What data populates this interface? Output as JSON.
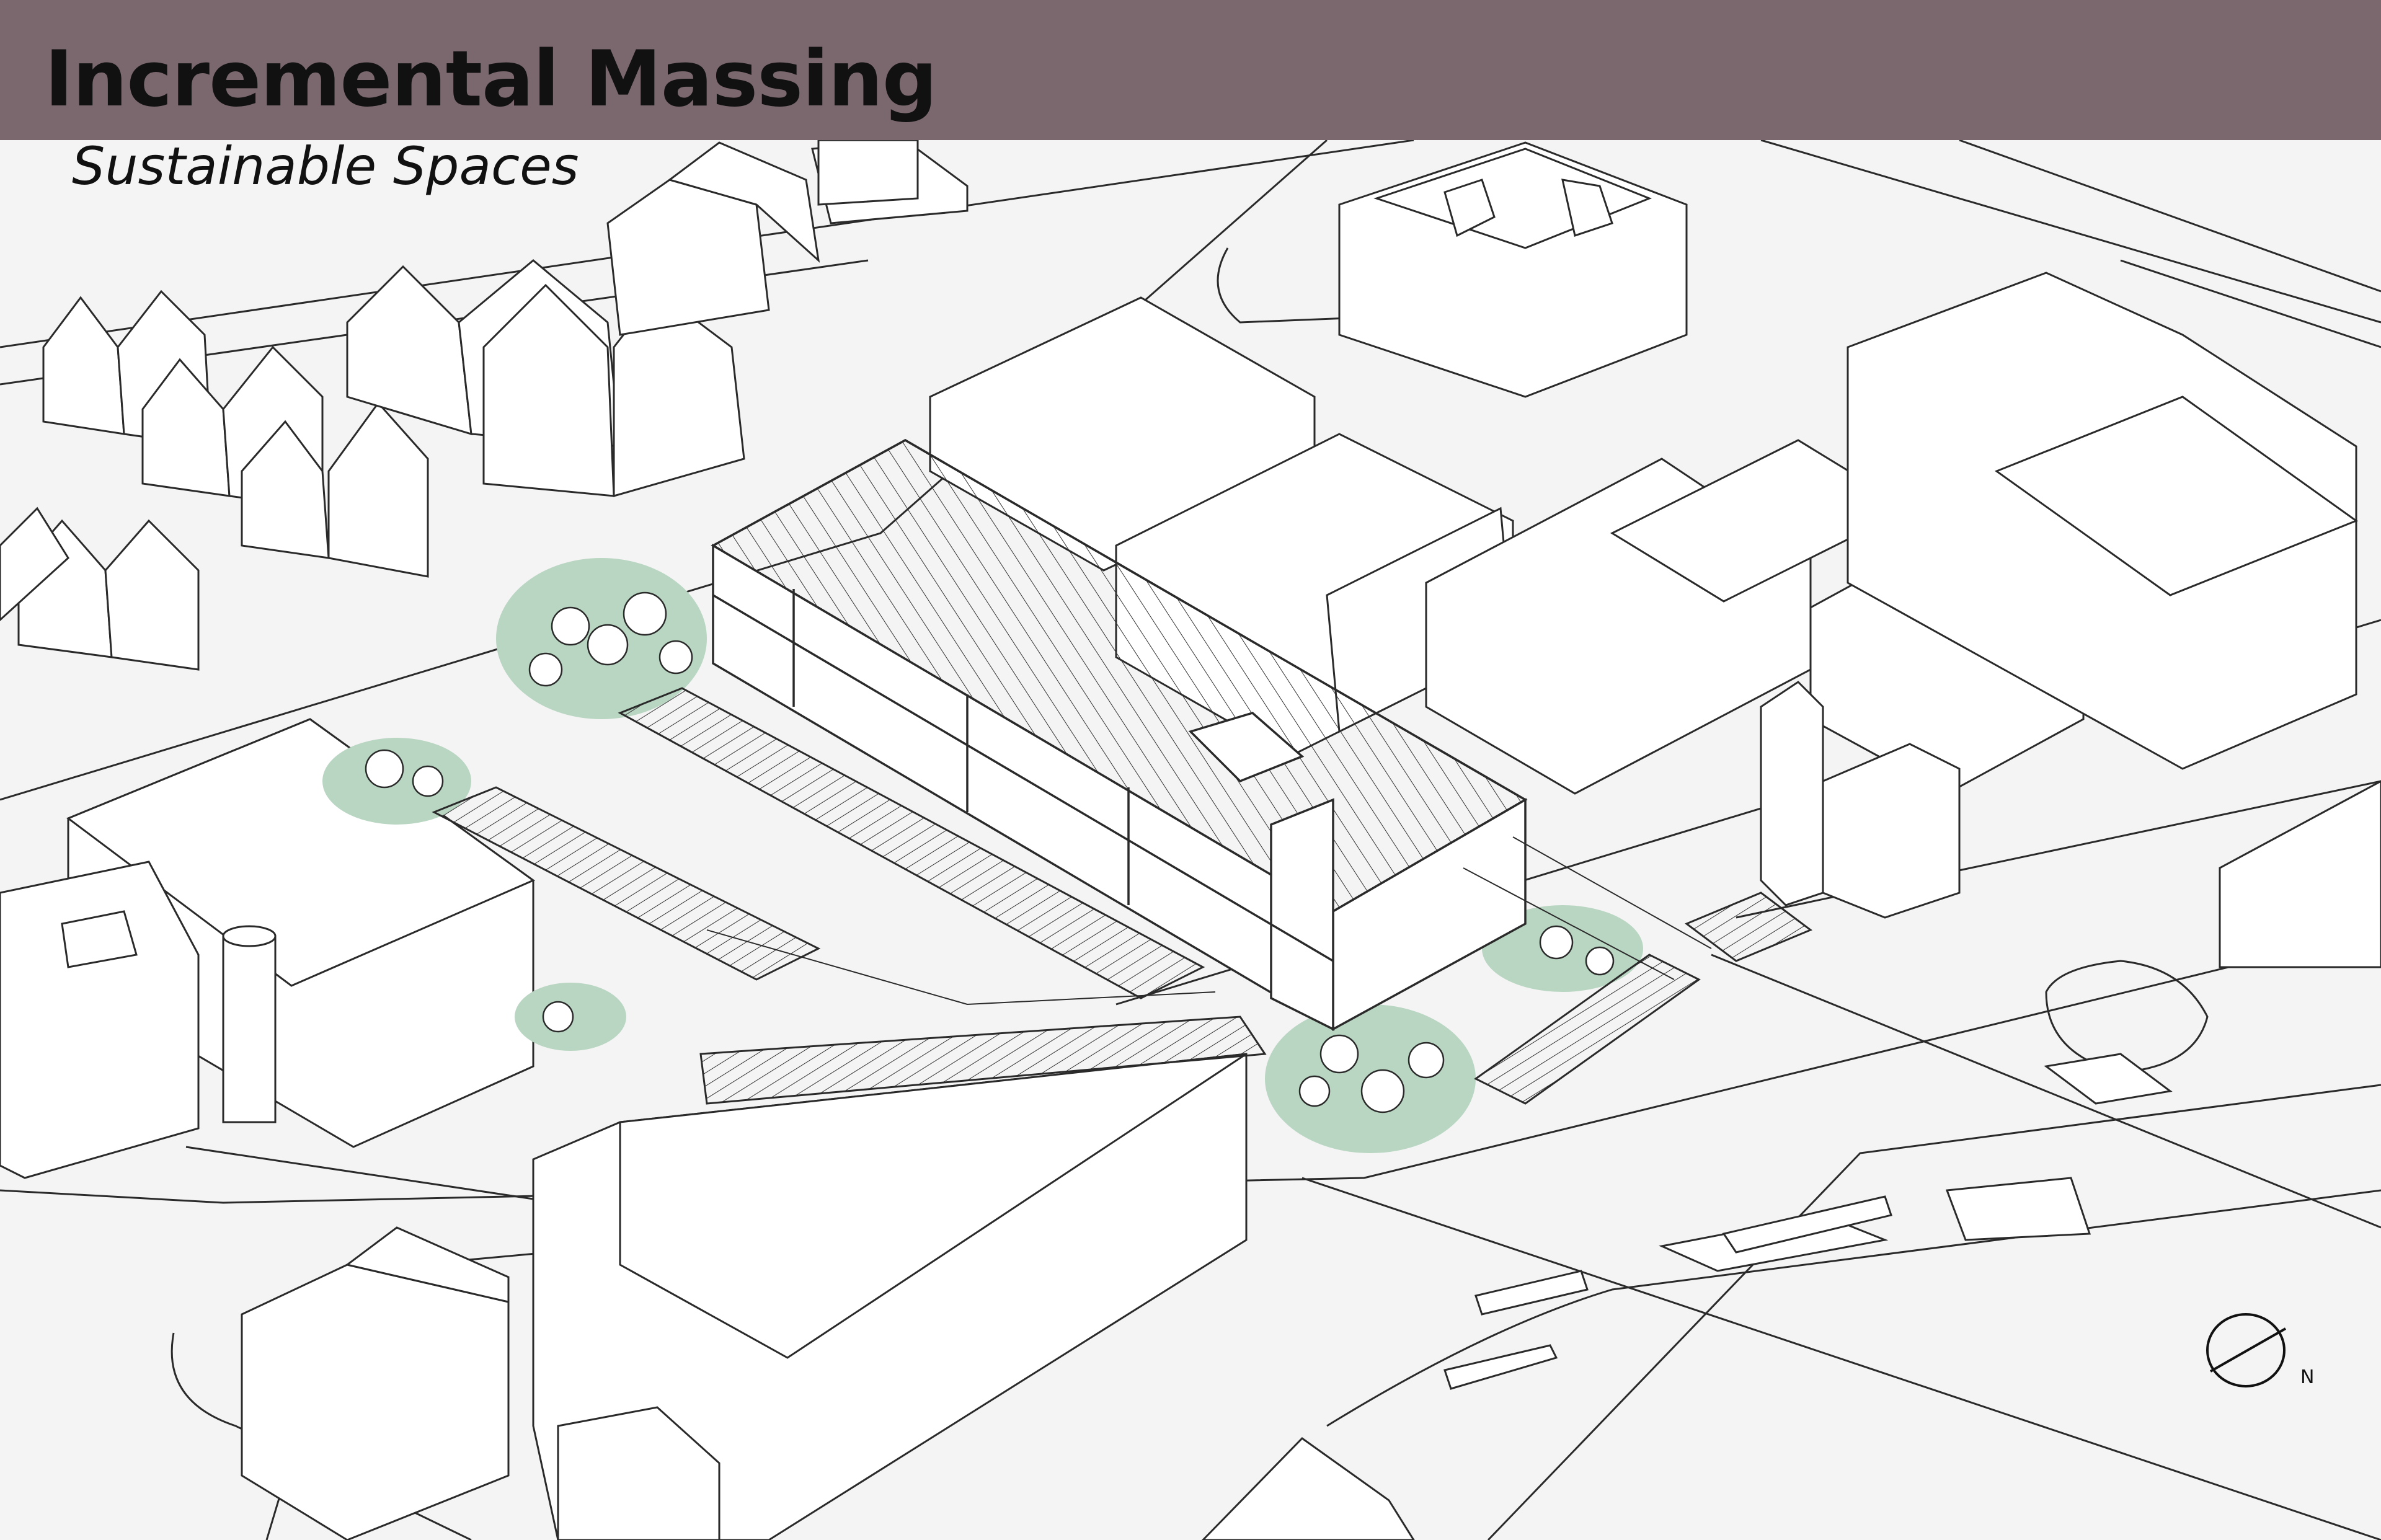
{
  "header": {
    "title": "Incremental Massing",
    "subtitle": "Sustainable Spaces",
    "bar_color": "#7b686f"
  },
  "drawing": {
    "line_color": "#2a2a2a",
    "mass_color": "#ffffff",
    "ground_color": "#f4f4f4",
    "green_space_color": "#b9d6c2"
  },
  "north_arrow": {
    "label": "N",
    "icon": "north-arrow-icon"
  }
}
